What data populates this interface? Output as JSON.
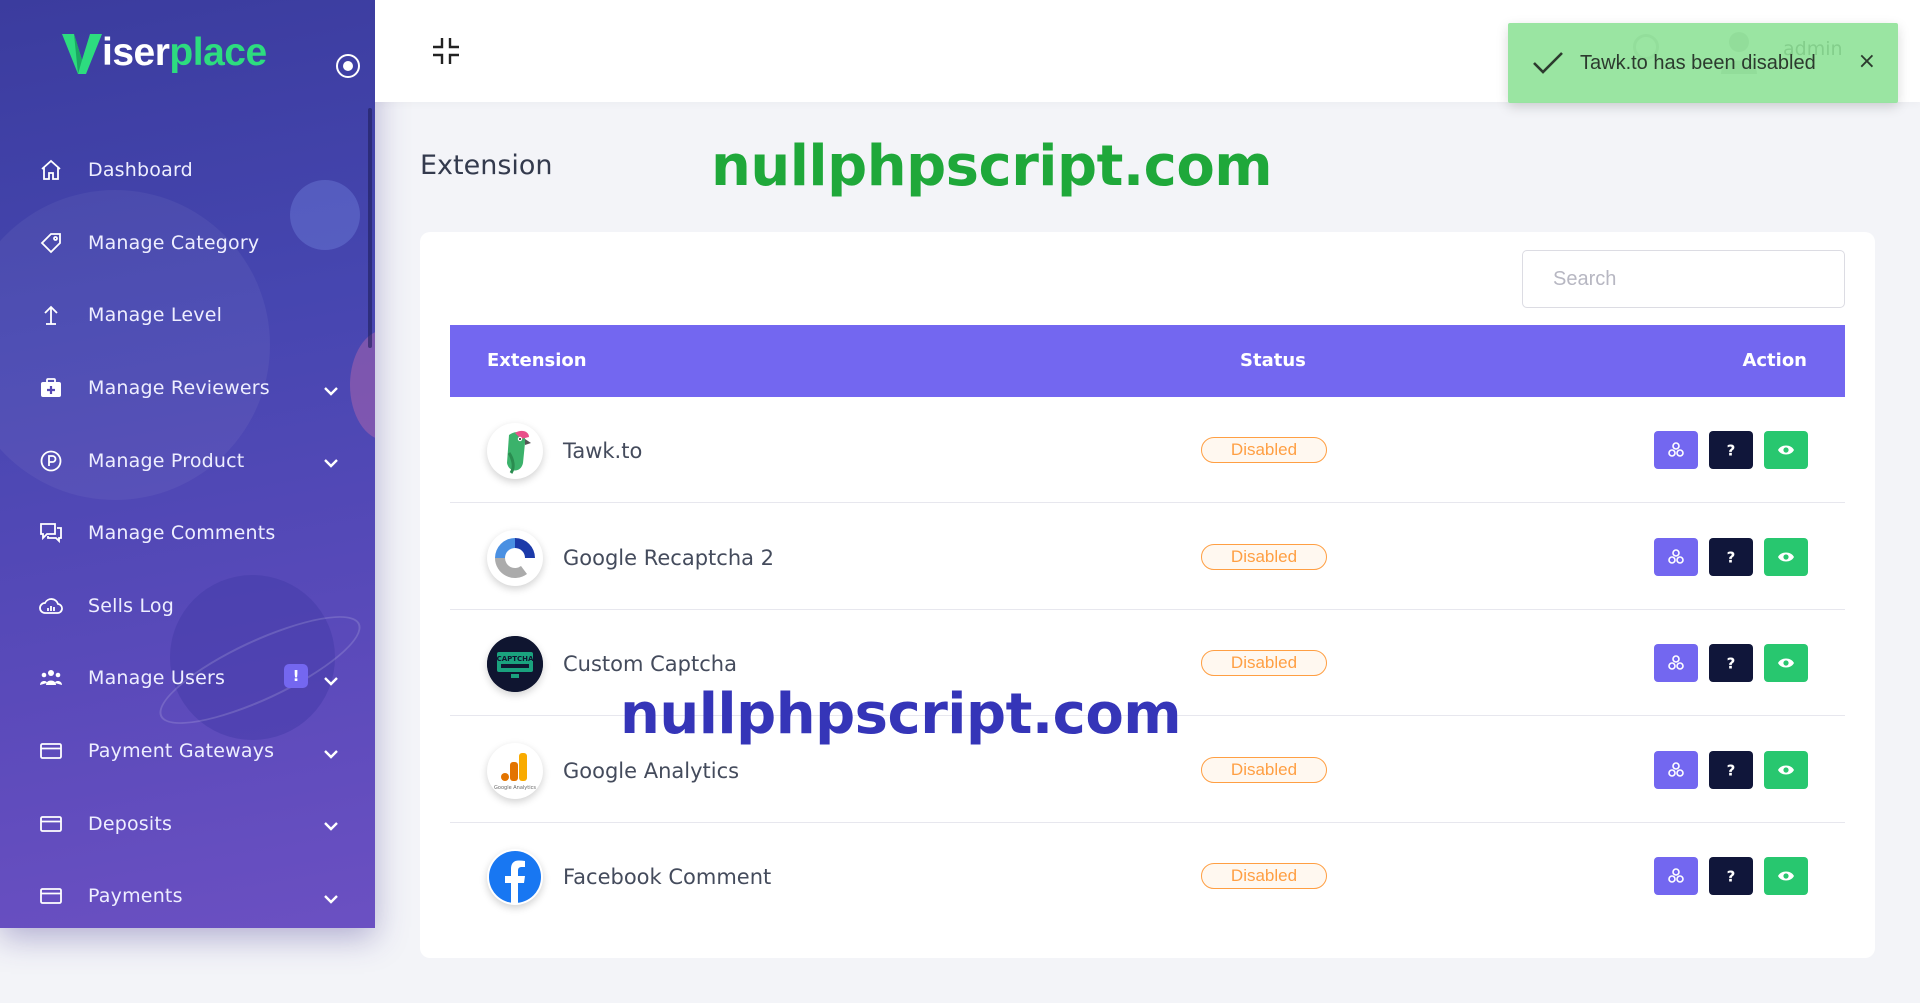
{
  "brand": {
    "logo_text_white": "iser",
    "logo_text_green": "place"
  },
  "sidebar": {
    "items": [
      {
        "label": "Dashboard",
        "icon": "home-icon",
        "has_submenu": false
      },
      {
        "label": "Manage Category",
        "icon": "tag-icon",
        "has_submenu": false
      },
      {
        "label": "Manage Level",
        "icon": "arrow-up-icon",
        "has_submenu": false
      },
      {
        "label": "Manage Reviewers",
        "icon": "briefcase-plus-icon",
        "has_submenu": true
      },
      {
        "label": "Manage Product",
        "icon": "product-p-icon",
        "has_submenu": true
      },
      {
        "label": "Manage Comments",
        "icon": "comments-icon",
        "has_submenu": false
      },
      {
        "label": "Sells Log",
        "icon": "cloud-chart-icon",
        "has_submenu": false
      },
      {
        "label": "Manage Users",
        "icon": "users-icon",
        "has_submenu": true,
        "badge": "!"
      },
      {
        "label": "Payment Gateways",
        "icon": "card-icon",
        "has_submenu": true
      },
      {
        "label": "Deposits",
        "icon": "card-icon",
        "has_submenu": true
      },
      {
        "label": "Payments",
        "icon": "card-icon",
        "has_submenu": true
      }
    ]
  },
  "header": {
    "admin_name": "admin"
  },
  "toast": {
    "message": "Tawk.to has been disabled",
    "close": "×"
  },
  "page": {
    "title": "Extension",
    "watermark_top": "nullphpscript.com",
    "watermark_mid": "nullphpscript.com"
  },
  "search": {
    "placeholder": "Search"
  },
  "table": {
    "headers": {
      "extension": "Extension",
      "status": "Status",
      "action": "Action"
    },
    "rows": [
      {
        "name": "Tawk.to",
        "status": "Disabled",
        "icon": "tawkto-parrot-icon"
      },
      {
        "name": "Google Recaptcha 2",
        "status": "Disabled",
        "icon": "recaptcha-icon"
      },
      {
        "name": "Custom Captcha",
        "status": "Disabled",
        "icon": "captcha-icon",
        "icon_text": "CAPTCHA"
      },
      {
        "name": "Google Analytics",
        "status": "Disabled",
        "icon": "google-analytics-icon",
        "icon_text": "Google Analytics"
      },
      {
        "name": "Facebook Comment",
        "status": "Disabled",
        "icon": "facebook-icon"
      }
    ],
    "action_buttons": [
      "configure-button",
      "help-button",
      "view-button"
    ]
  },
  "colors": {
    "primary": "#7367f0",
    "dark": "#10163a",
    "success": "#28c76f",
    "warning": "#ff9f43",
    "toast_bg": "#88e092",
    "watermark_green": "#1fa83a",
    "watermark_blue": "#3535b8"
  }
}
